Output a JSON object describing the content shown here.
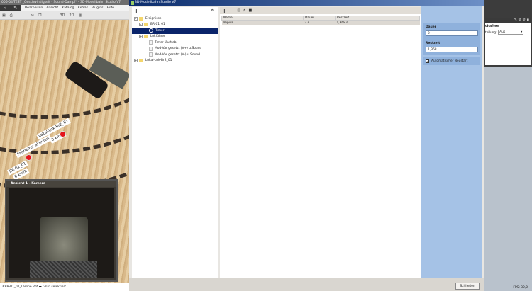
{
  "app": {
    "title": "006-04-TEST _Geschwindigkeit - Sound-Dampf* - 3D-Modellbahn Studio V7",
    "menu": [
      "Bearbeiten",
      "Ansicht",
      "Katalog",
      "Extras",
      "Plugins",
      "Hilfe"
    ],
    "toolbar": [
      "3D",
      "2D"
    ],
    "status": "#BR-01_01_Lampe Rot ▬ Grün selektiert",
    "fps": "FPS: 30,0"
  },
  "scene": {
    "labels": [
      "Fahrleiter aktiviert",
      "BR-01_01",
      "0 km/h",
      "Lokal-Lok-Br2_01",
      "0 km/h"
    ]
  },
  "camera": {
    "title": "Ansicht 1 - Kamera"
  },
  "dialog": {
    "title": "3D-Modellbahn Studio V7",
    "tree": [
      {
        "label": "Ereignisse",
        "level": 0,
        "type": "folder",
        "expander": "-"
      },
      {
        "label": "BR-01_01",
        "level": 1,
        "type": "folder",
        "expander": "-"
      },
      {
        "label": "Timer",
        "level": 2,
        "type": "timer",
        "selected": true
      },
      {
        "label": "Lokführer",
        "level": 1,
        "type": "folder",
        "expander": "+"
      },
      {
        "label": "Timer läuft ab",
        "level": 2,
        "type": "doc"
      },
      {
        "label": "Mod-Var gesetzt (V+) u.Sound",
        "level": 2,
        "type": "doc"
      },
      {
        "label": "Mod-Var gesetzt (V-) u.Sound",
        "level": 2,
        "type": "doc"
      },
      {
        "label": "Lokal-Lok-Br2_01",
        "level": 0,
        "type": "folder",
        "expander": "+"
      }
    ],
    "table": {
      "columns": [
        "Name",
        "Dauer",
        "Restzeit"
      ],
      "rows": [
        [
          "Impuls",
          "2 s",
          "1,368 s"
        ]
      ]
    },
    "props": {
      "dauer_label": "Dauer",
      "dauer_value": "2",
      "restzeit_label": "Restzeit",
      "restzeit_value": "1,368",
      "auto_label": "Automatischer Neustart",
      "auto_checked": true
    },
    "close_label": "Schließen"
  },
  "right_panel": {
    "title": "chaften",
    "field_label": "tellung:",
    "field_value": "Aus"
  }
}
